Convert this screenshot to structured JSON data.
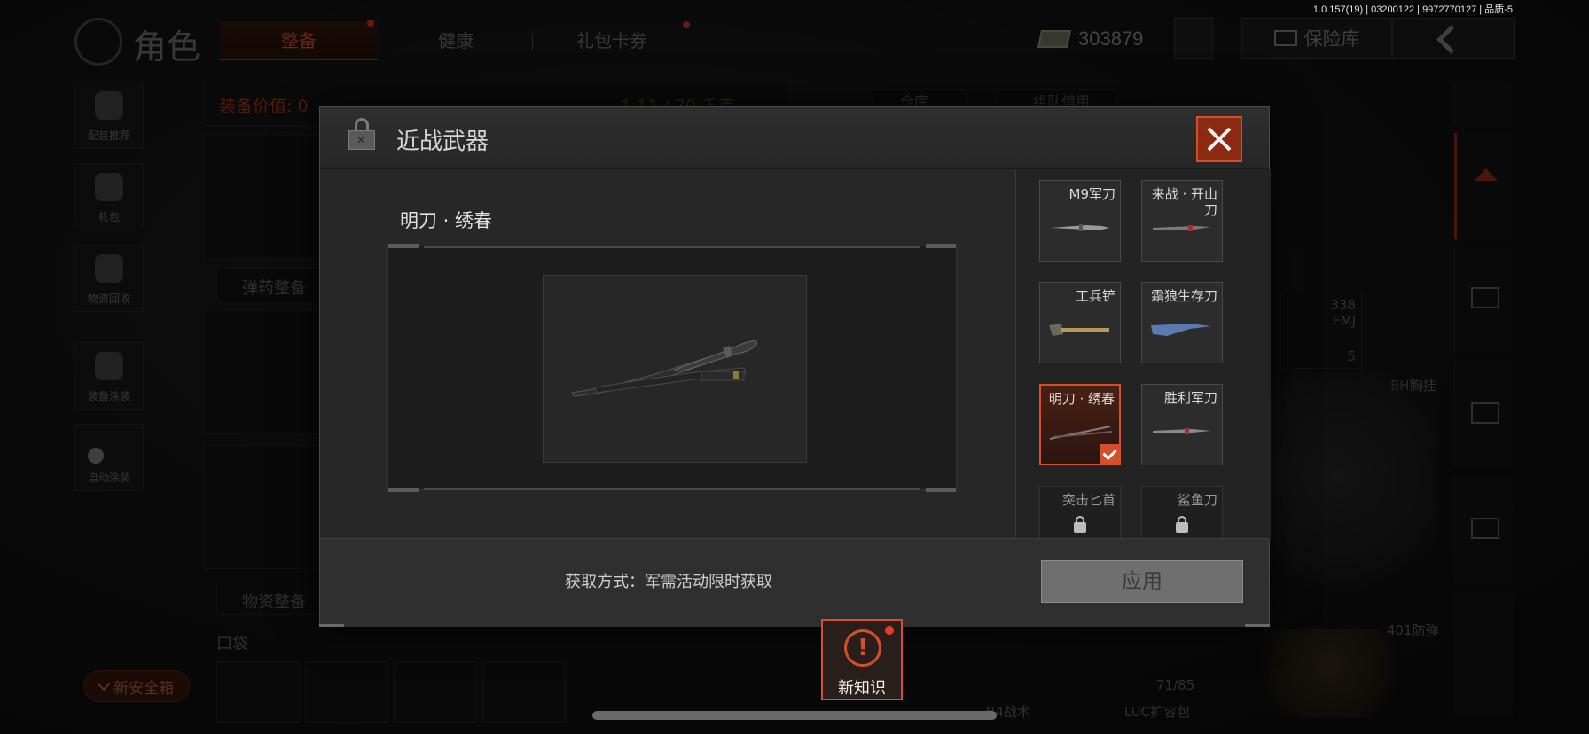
{
  "version_info": "1.0.157(19) | 03200122 | 9972770127 | 品质-5",
  "header": {
    "title": "角色",
    "tabs": [
      {
        "label": "整备",
        "active": true,
        "badge": true
      },
      {
        "label": "健康",
        "active": false,
        "badge": false
      },
      {
        "label": "礼包卡券",
        "active": false,
        "badge": true
      }
    ],
    "currency_value": "303879",
    "vault_label": "保险库"
  },
  "left_sidebar": [
    {
      "label": "配装推荐",
      "icon": "helmet-icon"
    },
    {
      "label": "礼包",
      "icon": "gift-icon"
    },
    {
      "label": "物资回收",
      "icon": "recycle-icon"
    },
    {
      "label": "装备涂装",
      "icon": "soldier-icon"
    },
    {
      "label": "自动涂装",
      "icon": "toggle-icon"
    }
  ],
  "background": {
    "gear_value_label": "装备价值: 0",
    "weight_label": "1.11 / 70 千克",
    "ammo_label": "弹药整备",
    "supply_label": "物资整备",
    "pocket_label": "口袋",
    "storage_tabs": [
      "仓库",
      "组队借用"
    ],
    "ammo_count": "338",
    "ammo_type": "FMJ",
    "ammo_qty": "5",
    "chest_label": "BH胸挂",
    "armor_label": "401防弹",
    "capacity": "71/85",
    "bag_label": "LUC扩容包",
    "tactical_label": "B4战术",
    "safe_box_label": "新安全箱"
  },
  "modal": {
    "title": "近战武器",
    "selected_name": "明刀 · 绣春",
    "weapons": [
      {
        "name": "M9军刀",
        "selected": false,
        "locked": false,
        "thumb_color": "#9a9a9a"
      },
      {
        "name": "来战 · 开山刀",
        "selected": false,
        "locked": false,
        "thumb_color": "#7a7a7a"
      },
      {
        "name": "工兵铲",
        "selected": false,
        "locked": false,
        "thumb_color": "#b59a5a"
      },
      {
        "name": "霜狼生存刀",
        "selected": false,
        "locked": false,
        "thumb_color": "#5a7ab0"
      },
      {
        "name": "明刀 · 绣春",
        "selected": true,
        "locked": false,
        "thumb_color": "#6a5a5a"
      },
      {
        "name": "胜利军刀",
        "selected": false,
        "locked": false,
        "thumb_color": "#8a8a8a"
      },
      {
        "name": "突击匕首",
        "selected": false,
        "locked": true,
        "thumb_color": "#4a4a4a"
      },
      {
        "name": "鲨鱼刀",
        "selected": false,
        "locked": true,
        "thumb_color": "#4a4a4a"
      }
    ],
    "acquire_text": "获取方式：军需活动限时获取",
    "apply_label": "应用"
  },
  "new_knowledge": {
    "label": "新知识",
    "icon": "!"
  },
  "colors": {
    "accent": "#d4502a",
    "badge": "#e53b2e",
    "modal_bg": "#262726"
  }
}
